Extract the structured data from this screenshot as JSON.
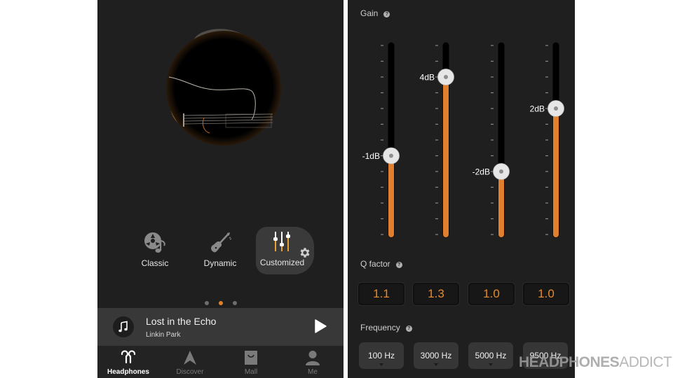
{
  "left_screen": {
    "album_art": "guitar-album-art",
    "sound_modes": [
      {
        "label": "Classic",
        "icon": "disc-music-icon",
        "active": false
      },
      {
        "label": "Dynamic",
        "icon": "electric-guitar-icon",
        "active": false
      },
      {
        "label": "Customized",
        "icon": "equalizer-sliders-icon",
        "active": true,
        "settings_icon": "gear-icon"
      }
    ],
    "page_dots": {
      "count": 3,
      "active_index": 1
    },
    "now_playing": {
      "icon": "music-note-icon",
      "title": "Lost in the Echo",
      "artist": "Linkin Park",
      "action_icon": "play-icon"
    },
    "bottom_nav": [
      {
        "label": "Headphones",
        "icon": "earbuds-icon",
        "active": true
      },
      {
        "label": "Discover",
        "icon": "compass-arrow-icon",
        "active": false
      },
      {
        "label": "Mall",
        "icon": "shopping-bag-icon",
        "active": false
      },
      {
        "label": "Me",
        "icon": "person-icon",
        "active": false
      }
    ]
  },
  "right_screen": {
    "gain": {
      "label": "Gain",
      "help_icon": "?",
      "range_db": [
        -6,
        6
      ],
      "step_db": 1,
      "bands": [
        {
          "value_db": -1,
          "label": "-1dB"
        },
        {
          "value_db": 4,
          "label": "4dB"
        },
        {
          "value_db": -2,
          "label": "-2dB"
        },
        {
          "value_db": 2,
          "label": "2dB"
        }
      ]
    },
    "q_factor": {
      "label": "Q factor",
      "help_icon": "?",
      "values": [
        "1.1",
        "1.3",
        "1.0",
        "1.0"
      ]
    },
    "frequency": {
      "label": "Frequency",
      "help_icon": "?",
      "values": [
        "100 Hz",
        "3000 Hz",
        "5000 Hz",
        "9500 Hz"
      ]
    }
  },
  "colors": {
    "accent": "#e07f2e",
    "background": "#1f1f1f",
    "track": "#000000",
    "thumb": "#e6e6e6"
  },
  "watermark": {
    "bold": "HEADPHONES",
    "light": "ADDICT"
  }
}
